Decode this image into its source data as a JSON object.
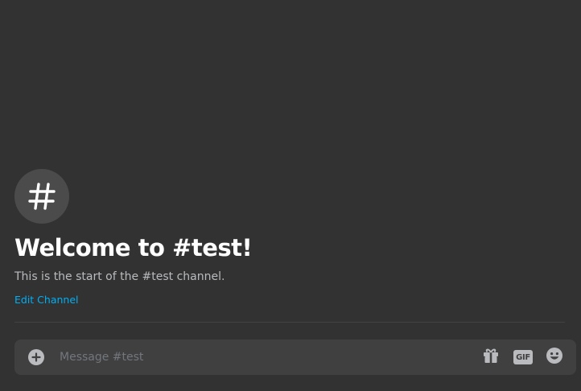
{
  "channel": {
    "icon": "hashtag-icon",
    "welcome_title": "Welcome to #test!",
    "welcome_subtitle": "This is the start of the #test channel.",
    "edit_label": "Edit Channel"
  },
  "composer": {
    "placeholder": "Message #test",
    "value": "",
    "buttons": {
      "attach": "add-circle-icon",
      "gift": "gift-icon",
      "gif": "GIF",
      "emoji": "emoji-icon"
    }
  },
  "colors": {
    "background": "#323232",
    "composer": "#404040",
    "link": "#00aff4",
    "muted_text": "#b9bbbe",
    "placeholder": "#72767d"
  }
}
